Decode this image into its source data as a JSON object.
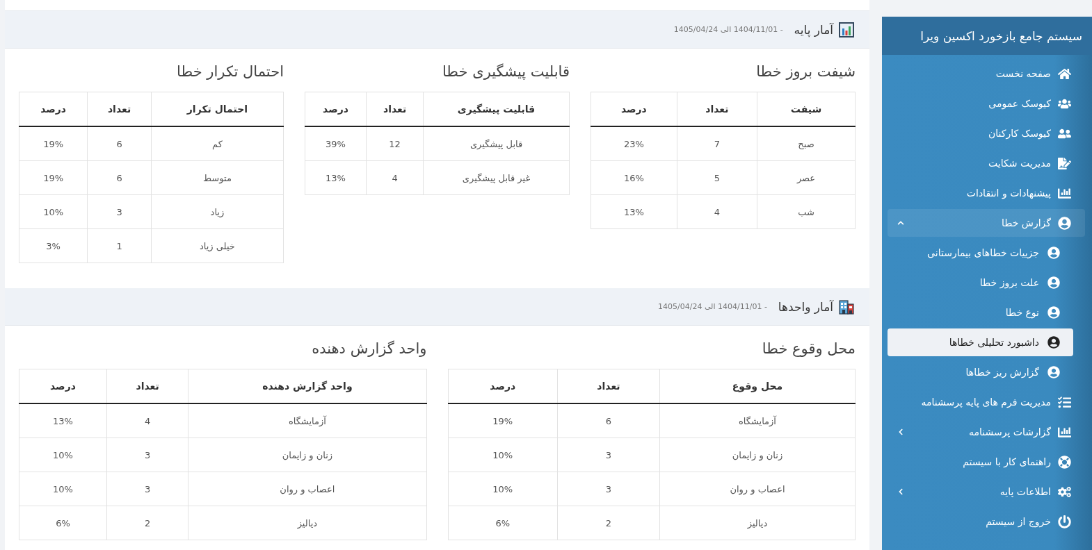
{
  "sidebar": {
    "title": "سیستم جامع بازخورد اکسین ویرا",
    "items": [
      {
        "label": "صفحه نخست",
        "kind": "link",
        "selected": false
      },
      {
        "label": "کیوسک عمومی",
        "kind": "link",
        "selected": false
      },
      {
        "label": "کیوسک کارکنان",
        "kind": "link",
        "selected": false
      },
      {
        "label": "مدیریت شکایت",
        "kind": "link",
        "selected": false
      },
      {
        "label": "پیشنهادات و انتقادات",
        "kind": "link",
        "selected": false
      },
      {
        "label": "گزارش خطا",
        "kind": "group",
        "expanded": true,
        "selected": false,
        "children": [
          {
            "label": "جزییات خطاهای بیمارستانی",
            "selected": false
          },
          {
            "label": "علت بروز خطا",
            "selected": false
          },
          {
            "label": "نوع خطا",
            "selected": false
          },
          {
            "label": "داشبورد تحلیلی خطاها",
            "selected": true
          },
          {
            "label": "گزارش ریز خطاها",
            "selected": false
          }
        ]
      },
      {
        "label": "مدیریت فرم های پایه پرسشنامه",
        "kind": "link",
        "selected": false
      },
      {
        "label": "گزارشات پرسشنامه",
        "kind": "group",
        "expanded": false,
        "selected": false
      },
      {
        "label": "راهنمای کار با سیستم",
        "kind": "link",
        "selected": false
      },
      {
        "label": "اطلاعات پایه",
        "kind": "group",
        "expanded": false,
        "selected": false
      },
      {
        "label": "خروج از سیستم",
        "kind": "link",
        "selected": false
      }
    ]
  },
  "sections": [
    {
      "title": "آمار پایه",
      "date_range": "- 1404/11/01 الی 1405/04/24",
      "tables": [
        {
          "title": "شیفت بروز خطا",
          "columns": [
            "شیفت",
            "تعداد",
            "درصد"
          ],
          "rows": [
            [
              "صبح",
              "7",
              "23%"
            ],
            [
              "عصر",
              "5",
              "16%"
            ],
            [
              "شب",
              "4",
              "13%"
            ]
          ]
        },
        {
          "title": "قابلیت پیشگیری خطا",
          "columns": [
            "قابلیت پیشگیری",
            "تعداد",
            "درصد"
          ],
          "rows": [
            [
              "قابل پیشگیری",
              "12",
              "39%"
            ],
            [
              "غیر قابل پیشگیری",
              "4",
              "13%"
            ]
          ]
        },
        {
          "title": "احتمال تکرار خطا",
          "columns": [
            "احتمال تکرار",
            "تعداد",
            "درصد"
          ],
          "rows": [
            [
              "کم",
              "6",
              "19%"
            ],
            [
              "متوسط",
              "6",
              "19%"
            ],
            [
              "زیاد",
              "3",
              "10%"
            ],
            [
              "خیلی زیاد",
              "1",
              "3%"
            ]
          ]
        }
      ]
    },
    {
      "title": "آمار واحدها",
      "date_range": "- 1404/11/01 الی 1405/04/24",
      "tables": [
        {
          "title": "محل وقوع خطا",
          "columns": [
            "محل وقوع",
            "تعداد",
            "درصد"
          ],
          "rows": [
            [
              "آزمایشگاه",
              "6",
              "19%"
            ],
            [
              "زنان و زایمان",
              "3",
              "10%"
            ],
            [
              "اعصاب و روان",
              "3",
              "10%"
            ],
            [
              "دیالیز",
              "2",
              "6%"
            ]
          ]
        },
        {
          "title": "واحد گزارش دهنده",
          "columns": [
            "واحد گزارش دهنده",
            "تعداد",
            "درصد"
          ],
          "rows": [
            [
              "آزمایشگاه",
              "4",
              "13%"
            ],
            [
              "زنان و زایمان",
              "3",
              "10%"
            ],
            [
              "اعصاب و روان",
              "3",
              "10%"
            ],
            [
              "دیالیز",
              "2",
              "6%"
            ]
          ]
        }
      ]
    }
  ]
}
